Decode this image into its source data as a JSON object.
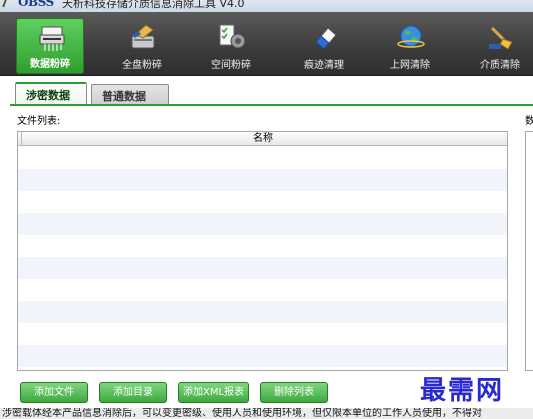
{
  "window": {
    "logo_text": "OBSS",
    "title": "天析科技存储介质信息消除工具 V4.0"
  },
  "toolbar": {
    "items": [
      {
        "label": "数据粉碎",
        "icon": "shredder-icon",
        "active": true
      },
      {
        "label": "全盘粉碎",
        "icon": "disk-shred-icon",
        "active": false
      },
      {
        "label": "空间粉碎",
        "icon": "space-shred-icon",
        "active": false
      },
      {
        "label": "痕迹清理",
        "icon": "eraser-icon",
        "active": false
      },
      {
        "label": "上网清除",
        "icon": "internet-globe-icon",
        "active": false
      },
      {
        "label": "介质清除",
        "icon": "media-clean-icon",
        "active": false
      }
    ]
  },
  "tabs": [
    {
      "label": "涉密数据",
      "active": true
    },
    {
      "label": "普通数据",
      "active": false
    }
  ],
  "main": {
    "file_list_label": "文件列表:",
    "right_label": "数",
    "column_name": "名称"
  },
  "buttons": {
    "add_file": "添加文件",
    "add_dir": "添加目录",
    "add_xml": "添加XML报表",
    "delete_list": "删除列表"
  },
  "watermark": "最需网",
  "status": {
    "text": "涉密载体经本产品信息消除后，可以变更密级、使用人员和使用环境，但仅限本单位的工作人员使用，不得对"
  },
  "colors": {
    "accent_green": "#3ea93e",
    "toolbar_dark": "#3b3b3b",
    "watermark_blue": "#2a2ad0"
  }
}
